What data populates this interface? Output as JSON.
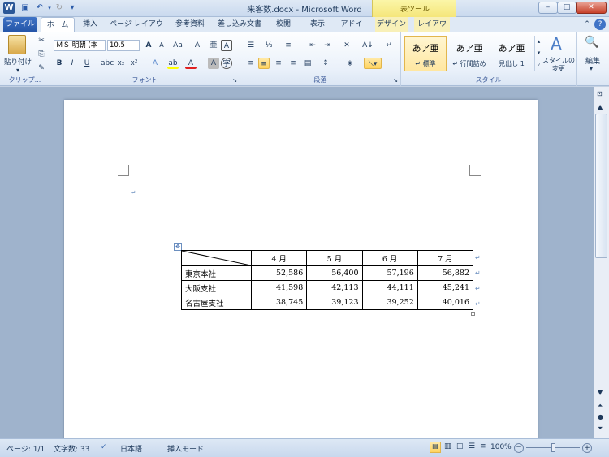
{
  "window": {
    "title": "来客数.docx - Microsoft Word",
    "context_group": "表ツール",
    "minimize": "–",
    "maximize": "□",
    "close": "✕"
  },
  "tabs": [
    "ファイル",
    "ホーム",
    "挿入",
    "ページ レイアウト",
    "参考資料",
    "差し込み文書",
    "校閲",
    "表示",
    "アドイン",
    "デザイン",
    "レイアウト"
  ],
  "ribbon": {
    "clipboard": {
      "paste": "貼り付け",
      "label": "クリップ..."
    },
    "font": {
      "name": "ＭＳ 明朝 (本",
      "size": "10.5",
      "label": "フォント"
    },
    "paragraph": {
      "label": "段落"
    },
    "styles": {
      "label": "スタイル",
      "items": [
        {
          "preview": "あア亜",
          "name": "↵ 標準"
        },
        {
          "preview": "あア亜",
          "name": "↵ 行間詰め"
        },
        {
          "preview": "あア亜",
          "name": "見出し 1"
        }
      ],
      "change": "スタイルの変更"
    },
    "editing": {
      "label": "編集"
    }
  },
  "table": {
    "headers": [
      "4 月",
      "5 月",
      "6 月",
      "7 月"
    ],
    "rows": [
      {
        "label": "東京本社",
        "values": [
          "52,586",
          "56,400",
          "57,196",
          "56,882"
        ]
      },
      {
        "label": "大阪支社",
        "values": [
          "41,598",
          "42,113",
          "44,111",
          "45,241"
        ]
      },
      {
        "label": "名古屋支社",
        "values": [
          "38,745",
          "39,123",
          "39,252",
          "40,016"
        ]
      }
    ]
  },
  "status": {
    "page": "ページ: 1/1",
    "words": "文字数: 33",
    "language": "日本語",
    "mode": "挿入モード",
    "zoom": "100%"
  }
}
